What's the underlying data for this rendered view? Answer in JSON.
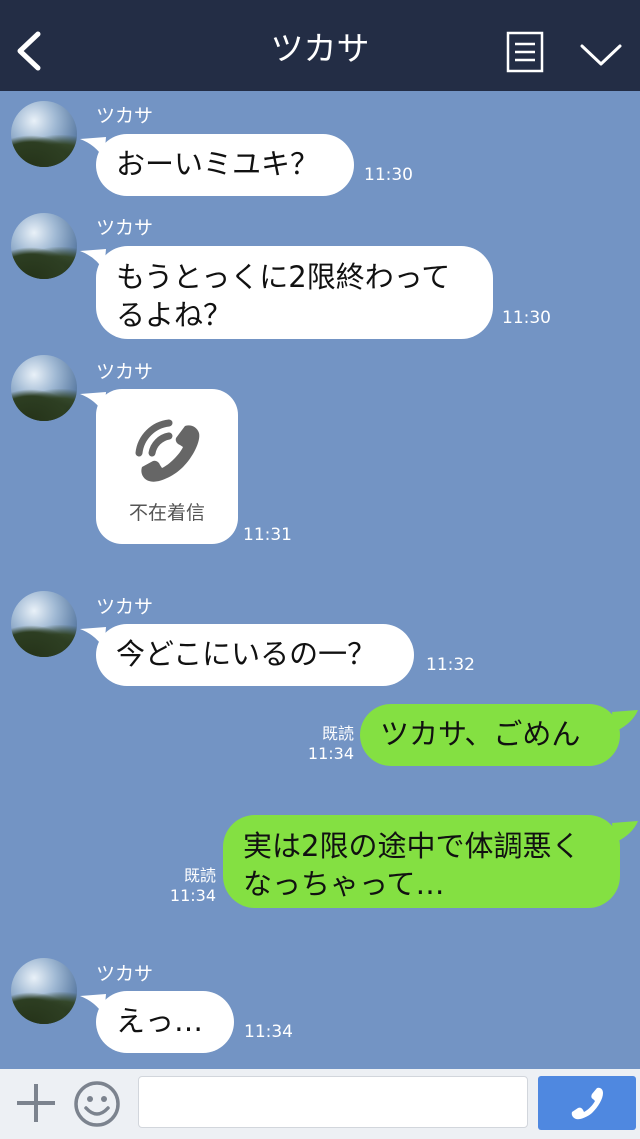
{
  "header": {
    "title": "ツカサ",
    "back_icon": "chevron-left-icon",
    "menu_icon": "menu-list-icon",
    "collapse_icon": "chevron-down-icon"
  },
  "messages": [
    {
      "sender": "ツカサ",
      "text_lines": [
        "おーいミユキ？"
      ],
      "time": "11:30"
    },
    {
      "sender": "ツカサ",
      "text_lines": [
        "もうとっくに2限終わって",
        "るよね？"
      ],
      "time": "11:30"
    },
    {
      "sender": "ツカサ",
      "call_label": "不在着信",
      "time": "11:31",
      "icon": "phone-icon"
    },
    {
      "sender": "ツカサ",
      "text_lines": [
        "今どこにいるの一？"
      ],
      "time": "11:32"
    },
    {
      "read": "既読",
      "text_lines": [
        "ツカサ、ごめん"
      ],
      "time": "11:34"
    },
    {
      "read": "既読",
      "text_lines": [
        "実は2限の途中で体調悪く",
        "なっちゃって…"
      ],
      "time": "11:34"
    },
    {
      "sender": "ツカサ",
      "text_lines": [
        "えっ…"
      ],
      "time": "11:34"
    }
  ],
  "footer": {
    "plus_icon": "plus-icon",
    "emoji_icon": "emoji-icon",
    "input_value": "",
    "send_icon": "phone-icon"
  },
  "colors": {
    "header_bg": "#232d45",
    "chat_bg": "#7394c4",
    "incoming_bubble": "#ffffff",
    "outgoing_bubble": "#84e042",
    "send_button": "#4f88e0"
  }
}
